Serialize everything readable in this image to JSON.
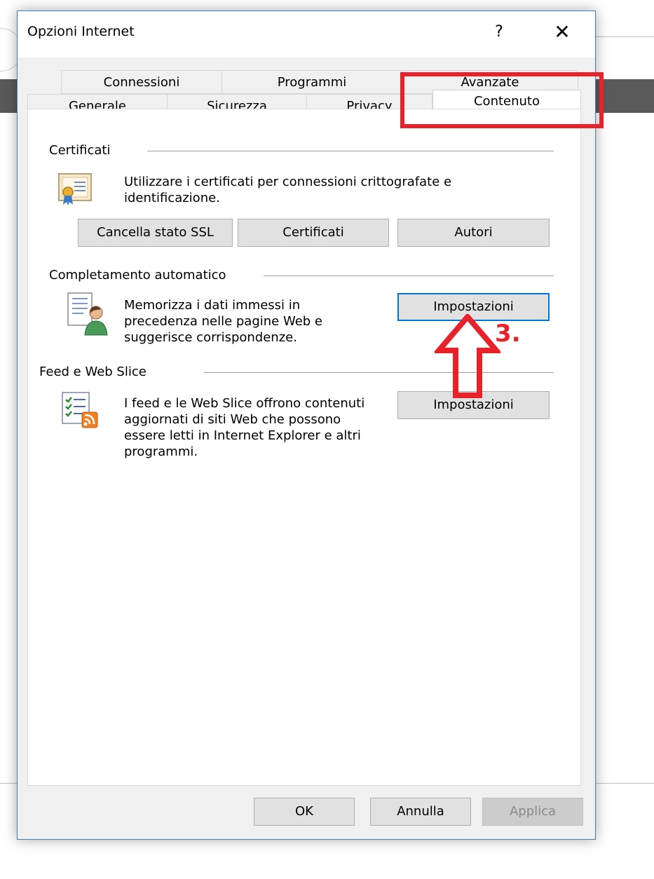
{
  "window": {
    "title": "Opzioni Internet",
    "help_glyph": "?",
    "close_glyph": "✕"
  },
  "tabs": {
    "row_top": [
      "Connessioni",
      "Programmi",
      "Avanzate"
    ],
    "row_bottom": [
      "Generale",
      "Sicurezza",
      "Privacy",
      "Contenuto"
    ],
    "selected": "Contenuto"
  },
  "certificati": {
    "heading": "Certificati",
    "description_line1": "Utilizzare i certificati per connessioni crittografate e",
    "description_line2": "identificazione.",
    "icon": "certificate-icon",
    "buttons": [
      "Cancella stato SSL",
      "Certificati",
      "Autori"
    ]
  },
  "completamento": {
    "heading": "Completamento automatico",
    "description_lines": [
      "Memorizza i dati immessi in",
      "precedenza nelle pagine Web e",
      "suggerisce corrispondenze."
    ],
    "icon": "autocomplete-user-icon",
    "button": "Impostazioni"
  },
  "feed": {
    "heading": "Feed e Web Slice",
    "description_lines": [
      "I feed e le Web Slice offrono contenuti",
      "aggiornati di siti Web che possono",
      "essere letti in Internet Explorer e altri",
      "programmi."
    ],
    "icon": "feed-rss-icon",
    "button": "Impostazioni"
  },
  "footer": {
    "ok": "OK",
    "annulla": "Annulla",
    "applica": "Applica"
  },
  "annotation": {
    "label": "3.",
    "color": "#e8222a"
  },
  "colors": {
    "focus_border": "#0078d7",
    "dialog_border": "#3d7ebf"
  }
}
